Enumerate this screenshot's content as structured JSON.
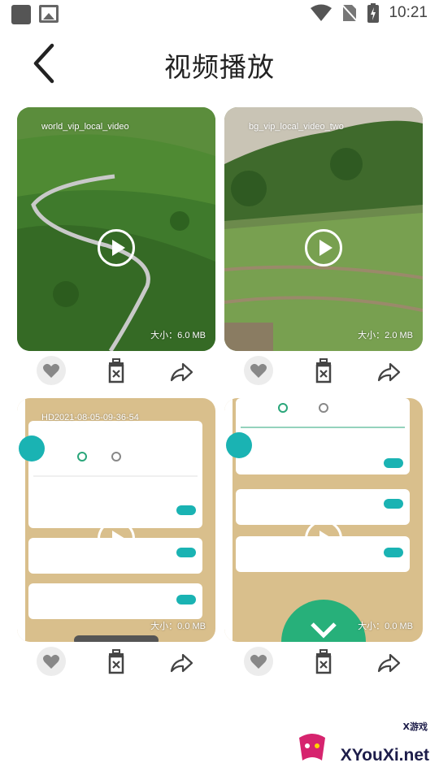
{
  "status_bar": {
    "time": "10:21"
  },
  "header": {
    "title": "视频播放"
  },
  "videos": [
    {
      "name": "world_vip_local_video",
      "size": "大小：6.0 MB"
    },
    {
      "name": "bg_vip_local_video_two",
      "size": "大小：2.0 MB"
    },
    {
      "name": "HD2021-08-05-09-36-54",
      "size": "大小：0.0 MB"
    },
    {
      "name": "",
      "size": "大小：0.0 MB"
    }
  ],
  "watermark": {
    "brand": "XYouXi.net",
    "small": "X游戏"
  }
}
